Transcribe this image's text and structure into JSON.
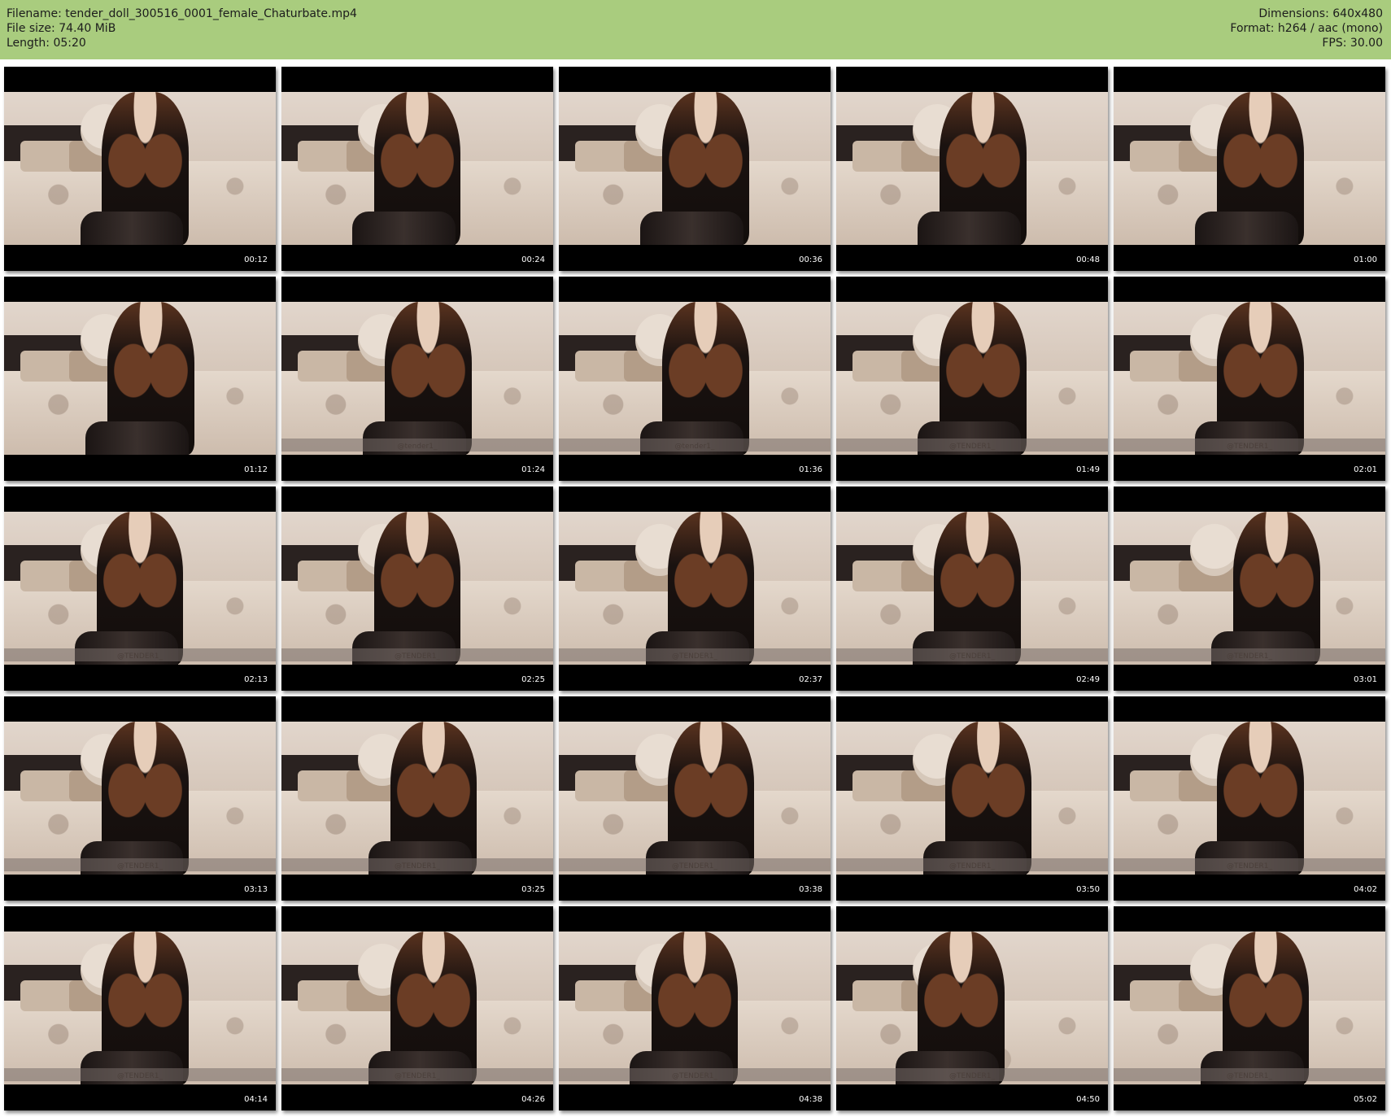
{
  "header": {
    "filename_label": "Filename: tender_doll_300516_0001_female_Chaturbate.mp4",
    "filesize_label": "File size: 74.40 MiB",
    "length_label": "Length: 05:20",
    "dimensions_label": "Dimensions: 640x480",
    "format_label": "Format: h264 / aac (mono)",
    "fps_label": "FPS: 30.00",
    "background_color": "#a9cc7e"
  },
  "thumbnails": [
    {
      "time": "00:12",
      "watermark": ""
    },
    {
      "time": "00:24",
      "watermark": ""
    },
    {
      "time": "00:36",
      "watermark": ""
    },
    {
      "time": "00:48",
      "watermark": ""
    },
    {
      "time": "01:00",
      "watermark": ""
    },
    {
      "time": "01:12",
      "watermark": ""
    },
    {
      "time": "01:24",
      "watermark": "@tender1_"
    },
    {
      "time": "01:36",
      "watermark": "@tender1_"
    },
    {
      "time": "01:49",
      "watermark": "@TENDER1_"
    },
    {
      "time": "02:01",
      "watermark": "@TENDER1_"
    },
    {
      "time": "02:13",
      "watermark": "@TENDER1_"
    },
    {
      "time": "02:25",
      "watermark": "@TENDER1_"
    },
    {
      "time": "02:37",
      "watermark": "@TENDER1_"
    },
    {
      "time": "02:49",
      "watermark": "@TENDER1_"
    },
    {
      "time": "03:01",
      "watermark": "@TENDER1_"
    },
    {
      "time": "03:13",
      "watermark": "@TENDER1_"
    },
    {
      "time": "03:25",
      "watermark": "@TENDER1_"
    },
    {
      "time": "03:38",
      "watermark": "@TENDER1_"
    },
    {
      "time": "03:50",
      "watermark": "@TENDER1_"
    },
    {
      "time": "04:02",
      "watermark": "@TENDER1_"
    },
    {
      "time": "04:14",
      "watermark": "@TENDER1_"
    },
    {
      "time": "04:26",
      "watermark": "@TENDER1_"
    },
    {
      "time": "04:38",
      "watermark": "@TENDER1_"
    },
    {
      "time": "04:50",
      "watermark": "@TENDER1_"
    },
    {
      "time": "05:02",
      "watermark": "@TENDER1_"
    }
  ]
}
